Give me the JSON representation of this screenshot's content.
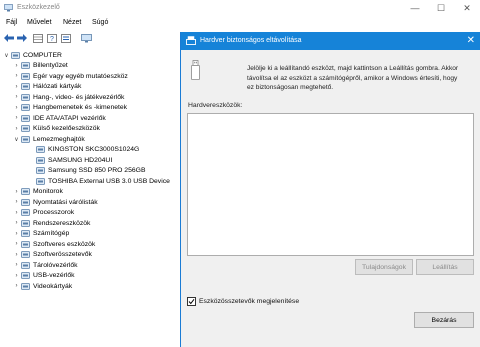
{
  "window": {
    "title": "Eszközkezelő"
  },
  "menu": [
    "Fájl",
    "Művelet",
    "Nézet",
    "Súgó"
  ],
  "tree": {
    "root": "COMPUTER",
    "categories": [
      {
        "label": "Billentyűzet",
        "icon": "keyboard-icon"
      },
      {
        "label": "Egér vagy egyéb mutatóeszköz",
        "icon": "mouse-icon"
      },
      {
        "label": "Hálózati kártyák",
        "icon": "network-adapter-icon"
      },
      {
        "label": "Hang-, video- és játékvezérlők",
        "icon": "speaker-icon"
      },
      {
        "label": "Hangbemenetek és -kimenetek",
        "icon": "audio-io-icon"
      },
      {
        "label": "IDE ATA/ATAPI vezérlők",
        "icon": "ide-controller-icon"
      },
      {
        "label": "Külső kezelőeszközök",
        "icon": "external-device-icon"
      },
      {
        "label": "Lemezmeghajtók",
        "icon": "disk-drive-icon",
        "expanded": true,
        "children": [
          "KINGSTON SKC3000S1024G",
          "SAMSUNG HD204UI",
          "Samsung SSD 850 PRO 256GB",
          "TOSHIBA External USB 3.0 USB Device"
        ]
      },
      {
        "label": "Monitorok",
        "icon": "monitor-icon"
      },
      {
        "label": "Nyomtatási várólisták",
        "icon": "printer-icon"
      },
      {
        "label": "Processzorok",
        "icon": "processor-icon"
      },
      {
        "label": "Rendszereszközök",
        "icon": "system-device-icon"
      },
      {
        "label": "Számítógép",
        "icon": "computer-icon"
      },
      {
        "label": "Szoftveres eszközök",
        "icon": "software-device-icon"
      },
      {
        "label": "Szoftverösszetevők",
        "icon": "software-component-icon"
      },
      {
        "label": "Tárolóvezérlők",
        "icon": "storage-controller-icon"
      },
      {
        "label": "USB-vezérlők",
        "icon": "usb-icon"
      },
      {
        "label": "Videokártyák",
        "icon": "video-card-icon"
      }
    ]
  },
  "dialog": {
    "title": "Hardver biztonságos eltávolítása",
    "instructions": "Jelölje ki a leállítandó eszközt, majd kattintson a Leállítás gombra. Akkor távolítsa el az eszközt a számítógépről, amikor a Windows értesíti, hogy ez biztonságosan megtehető.",
    "list_label": "Hardvereszközök:",
    "properties_button": "Tulajdonságok",
    "stop_button": "Leállítás",
    "show_components_label": "Eszközösszetevők megjelenítése",
    "show_components_checked": true,
    "close_button": "Bezárás"
  },
  "colors": {
    "accent": "#1683d8",
    "tree_icon": "#5a7fa8"
  }
}
